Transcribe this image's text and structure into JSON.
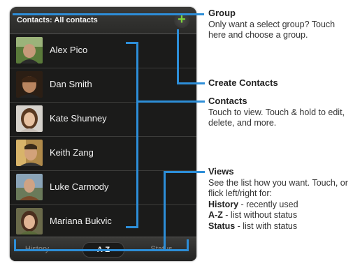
{
  "screen": {
    "group_title": "Contacts: All contacts",
    "add_button": "+",
    "contacts": [
      {
        "name": "Alex Pico",
        "avatar": "avatar-alex"
      },
      {
        "name": "Dan Smith",
        "avatar": "avatar-dan"
      },
      {
        "name": "Kate Shunney",
        "avatar": "avatar-kate"
      },
      {
        "name": "Keith Zang",
        "avatar": "avatar-keith"
      },
      {
        "name": "Luke Carmody",
        "avatar": "avatar-luke"
      },
      {
        "name": "Mariana Bukvic",
        "avatar": "avatar-mariana"
      }
    ],
    "tabs": [
      {
        "label": "History"
      },
      {
        "label": "A-Z",
        "active": true
      },
      {
        "label": "Status"
      }
    ]
  },
  "annotations": {
    "group": {
      "heading": "Group",
      "body": "Only want a select group? Touch here and choose a group."
    },
    "create": {
      "heading": "Create Contacts"
    },
    "contacts": {
      "heading": "Contacts",
      "body": "Touch to view. Touch & hold to edit, delete, and more."
    },
    "views": {
      "heading": "Views",
      "body": "See the list how you want. Touch, or flick left/right for:",
      "items": [
        {
          "term": "History",
          "desc": " - recently used"
        },
        {
          "term": "A-Z",
          "desc": " - list without status"
        },
        {
          "term": "Status",
          "desc": " - list with status"
        }
      ]
    }
  },
  "colors": {
    "callout": "#2d8ed8",
    "add_icon": "#7fd63a"
  }
}
